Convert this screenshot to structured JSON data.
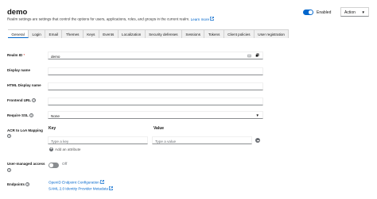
{
  "header": {
    "title": "demo",
    "subtitle": "Realm settings are settings that control the options for users, applications, roles, and groups in the current realm.",
    "learn_more": "Learn more",
    "enabled_label": "Enabled",
    "enabled": true,
    "action_label": "Action"
  },
  "tabs": [
    {
      "label": "General",
      "active": true
    },
    {
      "label": "Login"
    },
    {
      "label": "Email"
    },
    {
      "label": "Themes"
    },
    {
      "label": "Keys"
    },
    {
      "label": "Events"
    },
    {
      "label": "Localization"
    },
    {
      "label": "Security defenses"
    },
    {
      "label": "Sessions"
    },
    {
      "label": "Tokens"
    },
    {
      "label": "Client policies"
    },
    {
      "label": "User registration"
    }
  ],
  "form": {
    "realm_id": {
      "label": "Realm ID",
      "required": "*",
      "value": "demo"
    },
    "display_name": {
      "label": "Display name",
      "value": ""
    },
    "html_display_name": {
      "label": "HTML Display name",
      "value": ""
    },
    "frontend_url": {
      "label": "Frontend URL",
      "value": ""
    },
    "require_ssl": {
      "label": "Require SSL",
      "value": "None"
    },
    "acr_mapping": {
      "label": "ACR to LoA Mapping",
      "key_header": "Key",
      "value_header": "Value",
      "key_placeholder": "Type a key",
      "value_placeholder": "Type a value",
      "add_attribute": "Add an attribute"
    },
    "user_managed_access": {
      "label": "User-managed access",
      "state": "Off",
      "enabled": false
    },
    "endpoints": {
      "label": "Endpoints",
      "links": [
        "OpenID Endpoint Configuration",
        "SAML 2.0 Identity Provider Metadata"
      ]
    }
  },
  "colors": {
    "accent": "#0066cc",
    "required": "#c9190b",
    "border": "#8a8d90"
  }
}
